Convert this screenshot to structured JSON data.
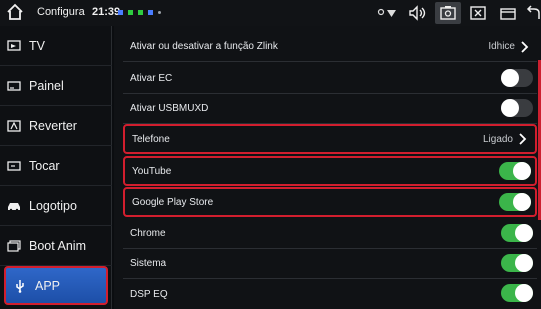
{
  "status_bar": {
    "title": "Configura",
    "time": "21:39",
    "icons": [
      "home-icon",
      "location-icon",
      "wifi-icon",
      "volume-icon",
      "screenshot-icon",
      "close-icon",
      "window-icon",
      "back-icon"
    ]
  },
  "sidebar": {
    "items": [
      {
        "label": "TV",
        "icon": "tv-icon"
      },
      {
        "label": "Painel",
        "icon": "panel-icon"
      },
      {
        "label": "Reverter",
        "icon": "reverse-camera-icon"
      },
      {
        "label": "Tocar",
        "icon": "touch-icon"
      },
      {
        "label": "Logotipo",
        "icon": "car-icon"
      },
      {
        "label": "Boot Anim",
        "icon": "boot-anim-icon"
      },
      {
        "label": "APP",
        "icon": "usb-icon",
        "active": true
      }
    ]
  },
  "settings": {
    "rows": [
      {
        "label": "Ativar ou desativar a função Zlink",
        "value": "Idhice",
        "type": "link"
      },
      {
        "label": "Ativar EC",
        "type": "toggle",
        "on": false
      },
      {
        "label": "Ativar USBMUXD",
        "type": "toggle",
        "on": false
      },
      {
        "label": "Telefone",
        "value": "Ligado",
        "type": "link",
        "highlighted": true
      },
      {
        "label": "YouTube",
        "type": "toggle",
        "on": true,
        "highlighted": true
      },
      {
        "label": "Google Play Store",
        "type": "toggle",
        "on": true,
        "highlighted": true
      },
      {
        "label": "Chrome",
        "type": "toggle",
        "on": true
      },
      {
        "label": "Sistema",
        "type": "toggle",
        "on": true
      },
      {
        "label": "DSP EQ",
        "type": "toggle",
        "on": true
      }
    ]
  },
  "colors": {
    "accent_blue": "#2f67c8",
    "toggle_on": "#3bb54a",
    "highlight_red": "#d21e2e"
  }
}
